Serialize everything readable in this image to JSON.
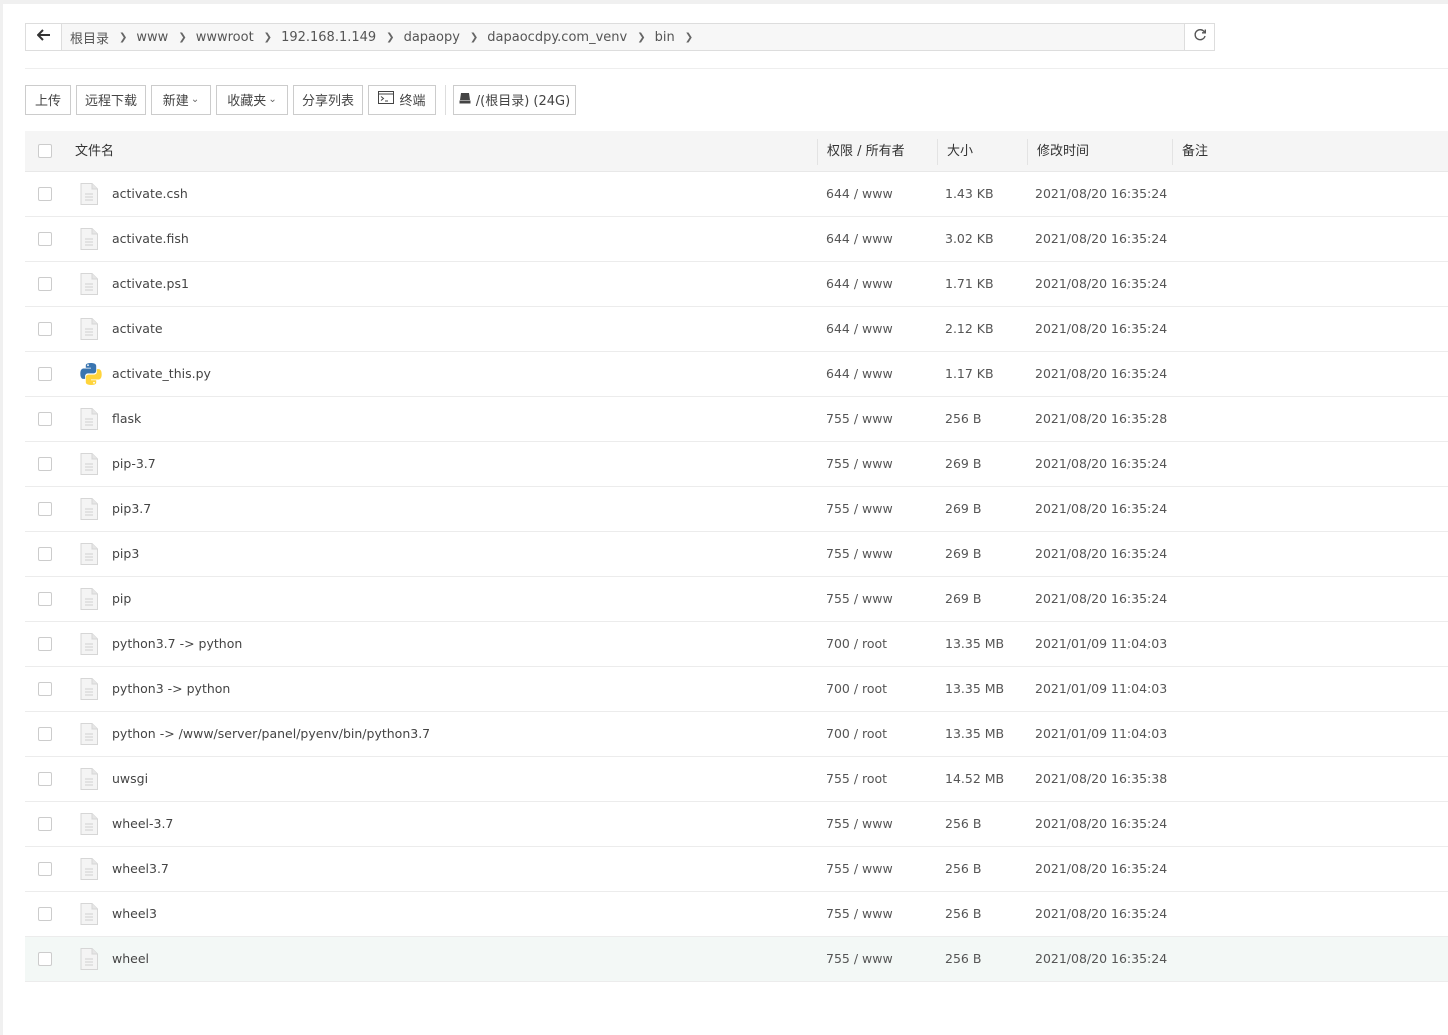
{
  "breadcrumbs": [
    {
      "label": "根目录"
    },
    {
      "label": "www"
    },
    {
      "label": "wwwroot"
    },
    {
      "label": "192.168.1.149"
    },
    {
      "label": "dapaopy"
    },
    {
      "label": "dapaocdpy.com_venv"
    },
    {
      "label": "bin"
    }
  ],
  "toolbar": {
    "upload": "上传",
    "remote_download": "远程下载",
    "new": "新建",
    "favorites": "收藏夹",
    "share_list": "分享列表",
    "terminal": "终端",
    "disk": "/(根目录) (24G)"
  },
  "columns": {
    "name": "文件名",
    "perm": "权限 / 所有者",
    "size": "大小",
    "mtime": "修改时间",
    "note": "备注"
  },
  "files": [
    {
      "name": "activate.csh",
      "perm": "644 / www",
      "size": "1.43 KB",
      "mtime": "2021/08/20 16:35:24",
      "icon": "file-icon"
    },
    {
      "name": "activate.fish",
      "perm": "644 / www",
      "size": "3.02 KB",
      "mtime": "2021/08/20 16:35:24",
      "icon": "file-icon"
    },
    {
      "name": "activate.ps1",
      "perm": "644 / www",
      "size": "1.71 KB",
      "mtime": "2021/08/20 16:35:24",
      "icon": "file-icon"
    },
    {
      "name": "activate",
      "perm": "644 / www",
      "size": "2.12 KB",
      "mtime": "2021/08/20 16:35:24",
      "icon": "file-icon"
    },
    {
      "name": "activate_this.py",
      "perm": "644 / www",
      "size": "1.17 KB",
      "mtime": "2021/08/20 16:35:24",
      "icon": "python-icon"
    },
    {
      "name": "flask",
      "perm": "755 / www",
      "size": "256 B",
      "mtime": "2021/08/20 16:35:28",
      "icon": "file-icon"
    },
    {
      "name": "pip-3.7",
      "perm": "755 / www",
      "size": "269 B",
      "mtime": "2021/08/20 16:35:24",
      "icon": "file-icon"
    },
    {
      "name": "pip3.7",
      "perm": "755 / www",
      "size": "269 B",
      "mtime": "2021/08/20 16:35:24",
      "icon": "file-icon"
    },
    {
      "name": "pip3",
      "perm": "755 / www",
      "size": "269 B",
      "mtime": "2021/08/20 16:35:24",
      "icon": "file-icon"
    },
    {
      "name": "pip",
      "perm": "755 / www",
      "size": "269 B",
      "mtime": "2021/08/20 16:35:24",
      "icon": "file-icon"
    },
    {
      "name": "python3.7 -> python",
      "perm": "700 / root",
      "size": "13.35 MB",
      "mtime": "2021/01/09 11:04:03",
      "icon": "file-icon"
    },
    {
      "name": "python3 -> python",
      "perm": "700 / root",
      "size": "13.35 MB",
      "mtime": "2021/01/09 11:04:03",
      "icon": "file-icon"
    },
    {
      "name": "python -> /www/server/panel/pyenv/bin/python3.7",
      "perm": "700 / root",
      "size": "13.35 MB",
      "mtime": "2021/01/09 11:04:03",
      "icon": "file-icon"
    },
    {
      "name": "uwsgi",
      "perm": "755 / root",
      "size": "14.52 MB",
      "mtime": "2021/08/20 16:35:38",
      "icon": "file-icon"
    },
    {
      "name": "wheel-3.7",
      "perm": "755 / www",
      "size": "256 B",
      "mtime": "2021/08/20 16:35:24",
      "icon": "file-icon"
    },
    {
      "name": "wheel3.7",
      "perm": "755 / www",
      "size": "256 B",
      "mtime": "2021/08/20 16:35:24",
      "icon": "file-icon"
    },
    {
      "name": "wheel3",
      "perm": "755 / www",
      "size": "256 B",
      "mtime": "2021/08/20 16:35:24",
      "icon": "file-icon"
    },
    {
      "name": "wheel",
      "perm": "755 / www",
      "size": "256 B",
      "mtime": "2021/08/20 16:35:24",
      "icon": "file-icon",
      "highlighted": true
    }
  ]
}
